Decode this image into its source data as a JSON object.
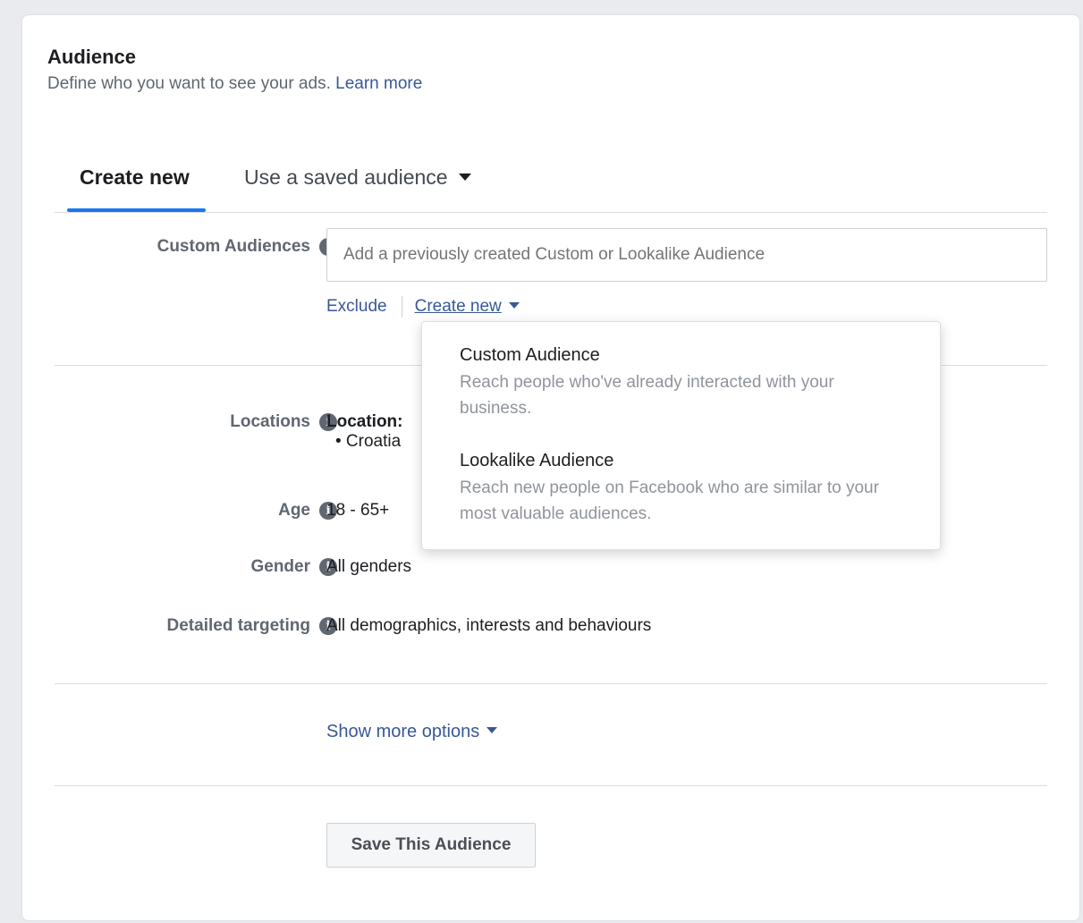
{
  "section": {
    "title": "Audience",
    "subtitle": "Define who you want to see your ads.",
    "learn_more": "Learn more"
  },
  "tabs": {
    "create_new": "Create new",
    "saved": "Use a saved audience"
  },
  "custom_audiences": {
    "label": "Custom Audiences",
    "placeholder": "Add a previously created Custom or Lookalike Audience",
    "exclude": "Exclude",
    "create_new": "Create new"
  },
  "locations": {
    "label": "Locations",
    "title": "Location:",
    "item": "• Croatia"
  },
  "age": {
    "label": "Age",
    "value": "18 - 65+"
  },
  "gender": {
    "label": "Gender",
    "value": "All genders"
  },
  "detailed": {
    "label": "Detailed targeting",
    "value": "All demographics, interests and behaviours"
  },
  "show_more": "Show more options",
  "save_button": "Save This Audience",
  "dropdown": {
    "items": [
      {
        "title": "Custom Audience",
        "desc": "Reach people who've already interacted with your business."
      },
      {
        "title": "Lookalike Audience",
        "desc": "Reach new people on Facebook who are similar to your most valuable audiences."
      }
    ]
  }
}
